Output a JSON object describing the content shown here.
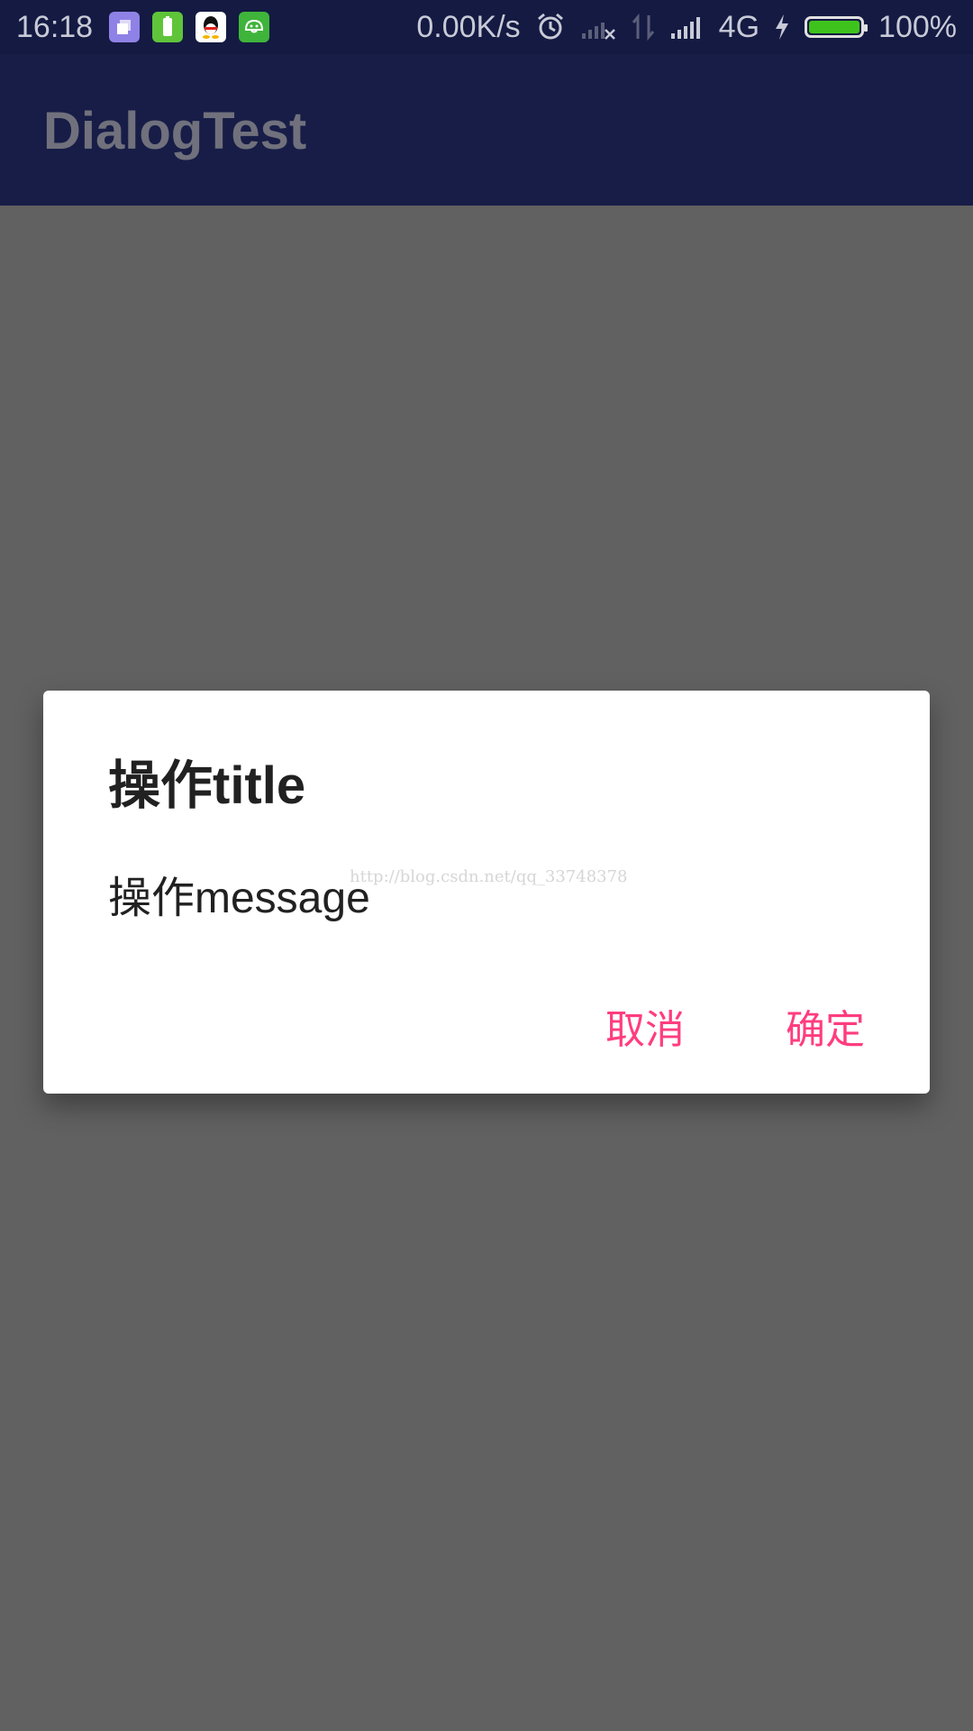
{
  "status_bar": {
    "time": "16:18",
    "net_speed": "0.00K/s",
    "network_type": "4G",
    "battery_percent_text": "100%",
    "battery_level": 1.0,
    "notification_icons": [
      "files-icon",
      "battery-saver-icon",
      "qq-icon",
      "android-icon"
    ],
    "colors": {
      "background": "#141a42",
      "battery_fill": "#3ec31c"
    }
  },
  "app_bar": {
    "title": "DialogTest",
    "colors": {
      "background": "#171d47"
    }
  },
  "dialog": {
    "title": "操作title",
    "message": "操作message",
    "cancel_label": "取消",
    "confirm_label": "确定",
    "accent_color": "#ff3d7f"
  },
  "watermark": "http://blog.csdn.net/qq_33748378"
}
